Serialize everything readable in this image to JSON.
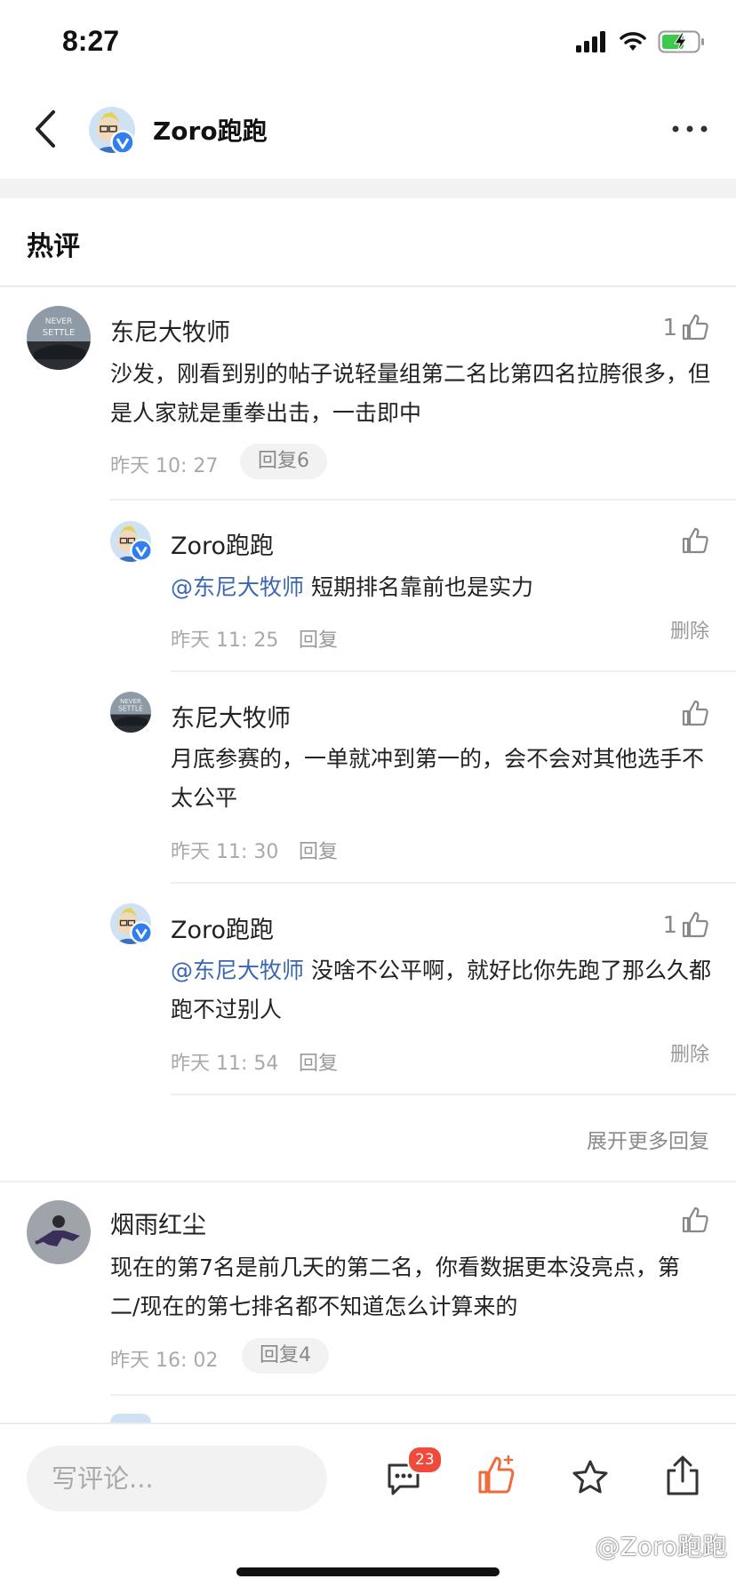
{
  "status_bar": {
    "time": "8:27"
  },
  "header": {
    "title": "Zoro跑跑"
  },
  "section": {
    "title": "热评"
  },
  "comments": [
    {
      "user": "东尼大牧师",
      "likes": "1",
      "text": "沙发，刚看到别的帖子说轻量组第二名比第四名拉胯很多，但是人家就是重拳出击，一击即中",
      "time": "昨天 10: 27",
      "reply_label": "回复6"
    },
    {
      "user": "烟雨红尘",
      "likes": "",
      "text": "现在的第7名是前几天的第二名，你看数据更本没亮点，第二/现在的第七排名都不知道怎么计算来的",
      "time": "昨天 16: 02",
      "reply_label": "回复4"
    }
  ],
  "replies": [
    {
      "user": "Zoro跑跑",
      "likes": "",
      "mention": "@东尼大牧师",
      "text": " 短期排名靠前也是实力",
      "time": "昨天 11: 25",
      "reply_label": "回复",
      "delete_label": "删除"
    },
    {
      "user": "东尼大牧师",
      "likes": "",
      "mention": "",
      "text": "月底参赛的，一单就冲到第一的，会不会对其他选手不太公平",
      "time": "昨天 11: 30",
      "reply_label": "回复"
    },
    {
      "user": "Zoro跑跑",
      "likes": "1",
      "mention": "@东尼大牧师",
      "text": " 没啥不公平啊，就好比你先跑了那么久都跑不过别人",
      "time": "昨天 11: 54",
      "reply_label": "回复",
      "delete_label": "删除"
    }
  ],
  "more_replies_label": "展开更多回复",
  "bottom_bar": {
    "input_placeholder": "写评论...",
    "comment_badge": "23",
    "like_icon": "thumbs-up-orange",
    "accent_color": "#f06a3a"
  },
  "watermark": "@Zoro跑跑",
  "avatar_texts": {
    "never": "NEVER",
    "settle": "SETTLE"
  }
}
